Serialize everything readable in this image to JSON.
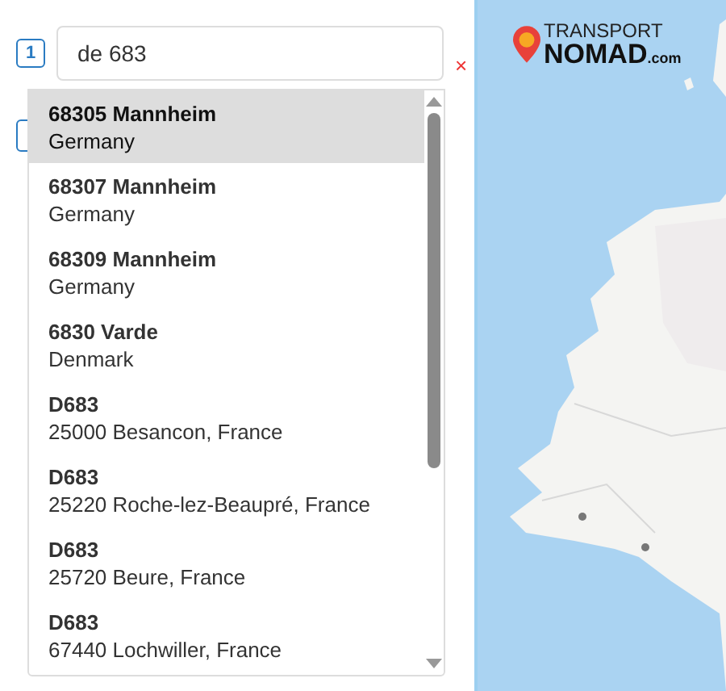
{
  "search": {
    "step": "1",
    "value": "de 683",
    "clear": "×"
  },
  "suggestions": [
    {
      "title": "68305 Mannheim",
      "subtitle": "Germany",
      "selected": true
    },
    {
      "title": "68307 Mannheim",
      "subtitle": "Germany",
      "selected": false
    },
    {
      "title": "68309 Mannheim",
      "subtitle": "Germany",
      "selected": false
    },
    {
      "title": "6830 Varde",
      "subtitle": "Denmark",
      "selected": false
    },
    {
      "title": "D683",
      "subtitle": "25000 Besancon, France",
      "selected": false
    },
    {
      "title": "D683",
      "subtitle": "25220 Roche-lez-Beaupré, France",
      "selected": false
    },
    {
      "title": "D683",
      "subtitle": "25720 Beure, France",
      "selected": false
    },
    {
      "title": "D683",
      "subtitle": "67440 Lochwiller, France",
      "selected": false
    }
  ],
  "logo": {
    "line1": "TRANSPORT",
    "line2": "NOMAD",
    "suffix": ".com"
  }
}
